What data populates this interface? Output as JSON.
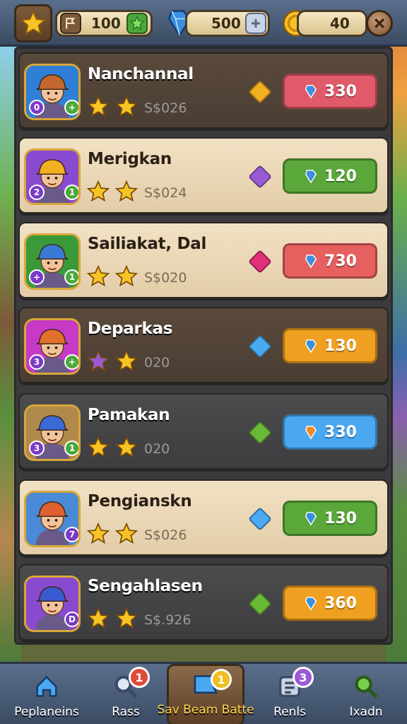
{
  "colors": {
    "gold": "#f7c325",
    "gem_blue": "#3a8fe0",
    "buy_red": "#e05a5a",
    "buy_green": "#5aa83a",
    "buy_orange": "#f0a020",
    "buy_blue": "#4aa8f0"
  },
  "topbar": {
    "trophy_value": "100",
    "gems_value": "500",
    "coins_value": "40",
    "star_icon": "star-icon",
    "close_icon": "close-icon"
  },
  "list": [
    {
      "name": "Nanchannal",
      "stars": 2,
      "price": "S$026",
      "diamond_color": "#f0b020",
      "buy_value": "330",
      "buy_color": "#e05a6a",
      "style": "dark",
      "badges": [
        "0",
        "+"
      ],
      "helmet": "#c2682e",
      "avatar_bg": "#2f7fd6"
    },
    {
      "name": "Merigkan",
      "stars": 2,
      "price": "S$024",
      "diamond_color": "#9a5ad6",
      "buy_value": "120",
      "buy_color": "#5aa83a",
      "style": "light",
      "badges": [
        "2",
        "1"
      ],
      "helmet": "#f0b020",
      "avatar_bg": "#8a4ad0"
    },
    {
      "name": "Sailiakat, Dal",
      "stars": 2,
      "price": "S$020",
      "diamond_color": "#e0307a",
      "buy_value": "730",
      "buy_color": "#e66060",
      "style": "light",
      "badges": [
        "+",
        "1"
      ],
      "helmet": "#3a7ad6",
      "avatar_bg": "#3a9a3a"
    },
    {
      "name": "Deparkas",
      "stars": 2,
      "price": "020",
      "diamond_color": "#4aaaf0",
      "buy_value": "130",
      "buy_color": "#f0a020",
      "style": "dark",
      "badges": [
        "3",
        "+"
      ],
      "helmet": "#e0702a",
      "avatar_bg": "#c63ac6",
      "first_star_purple": true
    },
    {
      "name": "Pamakan",
      "stars": 2,
      "price": "020",
      "diamond_color": "#6aba3a",
      "buy_value": "330",
      "buy_color": "#4aa8f0",
      "style": "dim",
      "badges": [
        "3",
        "1"
      ],
      "helmet": "#3a6ad6",
      "avatar_bg": "#b08a4a"
    },
    {
      "name": "Pengianskn",
      "stars": 2,
      "price": "S$026",
      "diamond_color": "#4aaaf0",
      "buy_value": "130",
      "buy_color": "#5aa83a",
      "style": "light",
      "badges": [
        "7"
      ],
      "helmet": "#e06030",
      "avatar_bg": "#4a8ad6"
    },
    {
      "name": "Sengahlasen",
      "stars": 2,
      "price": "S$.926",
      "diamond_color": "#6aba3a",
      "buy_value": "360",
      "buy_color": "#f0a020",
      "style": "dim",
      "badges": [
        "D"
      ],
      "helmet": "#3a5ad0",
      "avatar_bg": "#8a4ad0"
    }
  ],
  "nav": [
    {
      "label": "Peplaneins",
      "icon": "home-icon",
      "badge": ""
    },
    {
      "label": "Rass",
      "icon": "magnifier-icon",
      "badge": "1"
    },
    {
      "label": "Sav Beam Batte",
      "icon": "battle-flag-icon",
      "badge": "1",
      "active": true
    },
    {
      "label": "Renls",
      "icon": "scroll-icon",
      "badge": "3"
    },
    {
      "label": "Ixadn",
      "icon": "search-icon",
      "badge": ""
    }
  ]
}
